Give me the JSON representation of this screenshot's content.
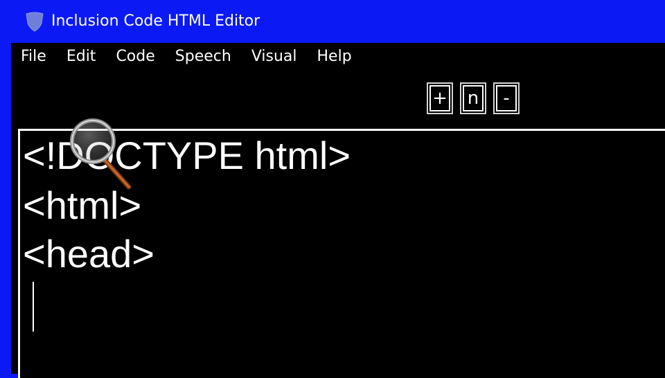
{
  "app": {
    "title": "Inclusion Code HTML Editor",
    "icon": "shield-icon",
    "accent_color": "#0b19f5"
  },
  "menu": {
    "items": [
      {
        "label": "File"
      },
      {
        "label": "Edit"
      },
      {
        "label": "Code"
      },
      {
        "label": "Speech"
      },
      {
        "label": "Visual"
      },
      {
        "label": "Help"
      }
    ]
  },
  "toolbar": {
    "zoom_in_label": "+",
    "normal_label": "n",
    "zoom_out_label": "-"
  },
  "editor": {
    "lines": [
      "<!DOCTYPE html>",
      "<html>",
      "<head>"
    ],
    "cursor_icon": "magnifier-icon"
  }
}
